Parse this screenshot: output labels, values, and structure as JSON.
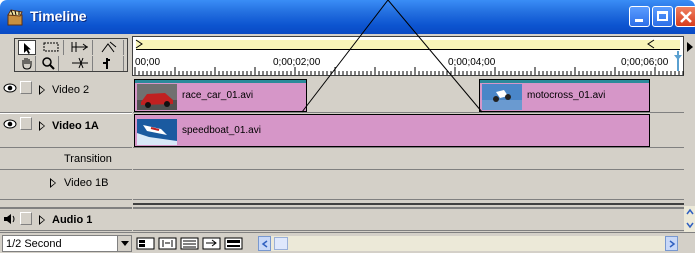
{
  "window": {
    "title": "Timeline",
    "title_icon": "clapperboard-icon",
    "title_bar_color": "#0c54d0"
  },
  "tools": [
    "selection-icon",
    "range-select-icon",
    "track-select-icon",
    "rolling-edit-icon",
    "hand-icon",
    "zoom-icon",
    "razor-icon",
    "in-out-icon"
  ],
  "ruler": {
    "work_area_color": "#f8f5b8",
    "ticks": [
      "00;00",
      "0;00;02;00",
      "0;00;04;00",
      "0;00;06;00"
    ]
  },
  "tracks": [
    {
      "name": "Video 2",
      "bold": false
    },
    {
      "name": "Video 1A",
      "bold": true
    },
    {
      "name": "Transition",
      "bold": false
    },
    {
      "name": "Video 1B",
      "bold": false
    },
    {
      "name": "Audio 1",
      "bold": true
    }
  ],
  "clips": [
    {
      "label": "race_car_01.avi",
      "track": "Video 2",
      "thumb": "race-car-thumbnail"
    },
    {
      "label": "motocross_01.avi",
      "track": "Video 2",
      "thumb": "motocross-thumbnail"
    },
    {
      "label": "speedboat_01.avi",
      "track": "Video 1A",
      "thumb": "speedboat-thumbnail"
    }
  ],
  "clip_color": "#d696c8",
  "bottom": {
    "time_unit": "1/2 Second"
  }
}
